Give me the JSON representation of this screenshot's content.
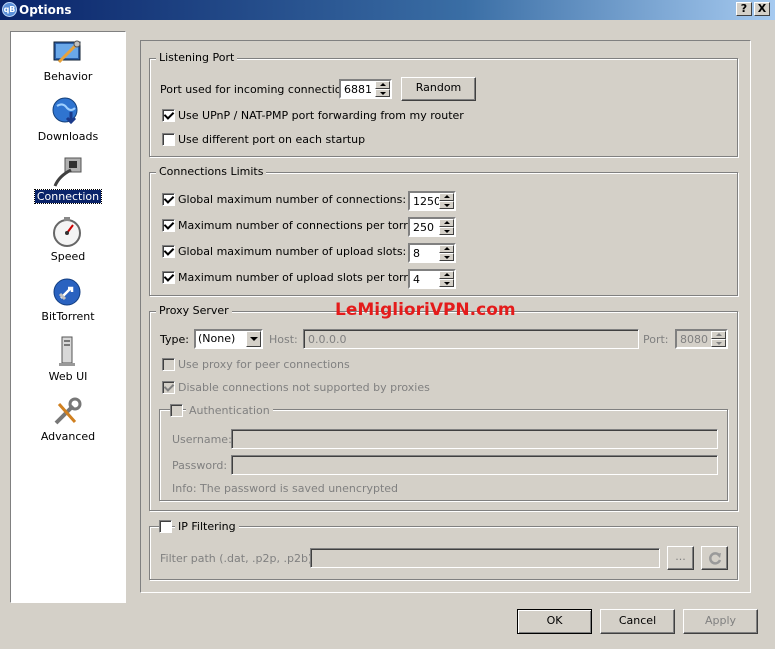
{
  "window": {
    "title": "Options",
    "help_label": "?",
    "close_label": "X"
  },
  "sidebar": {
    "items": [
      {
        "label": "Behavior",
        "icon": "behavior-icon",
        "selected": false
      },
      {
        "label": "Downloads",
        "icon": "downloads-globe-icon",
        "selected": false
      },
      {
        "label": "Connection",
        "icon": "connection-icon",
        "selected": true
      },
      {
        "label": "Speed",
        "icon": "speed-gauge-icon",
        "selected": false
      },
      {
        "label": "BitTorrent",
        "icon": "bittorrent-icon",
        "selected": false
      },
      {
        "label": "Web UI",
        "icon": "web-ui-icon",
        "selected": false
      },
      {
        "label": "Advanced",
        "icon": "advanced-tools-icon",
        "selected": false
      }
    ]
  },
  "listening_port": {
    "title": "Listening Port",
    "port_label": "Port used for incoming connections:",
    "port_value": "6881",
    "random_button": "Random",
    "upnp_label": "Use UPnP / NAT-PMP port forwarding from my router",
    "upnp_checked": true,
    "diff_port_label": "Use different port on each startup",
    "diff_port_checked": false
  },
  "connection_limits": {
    "title": "Connections Limits",
    "rows": [
      {
        "label": "Global maximum number of connections:",
        "value": "1250",
        "checked": true
      },
      {
        "label": "Maximum number of connections per torrent:",
        "value": "250",
        "checked": true
      },
      {
        "label": "Global maximum number of upload slots:",
        "value": "8",
        "checked": true
      },
      {
        "label": "Maximum number of upload slots per torrent:",
        "value": "4",
        "checked": true
      }
    ]
  },
  "proxy": {
    "title": "Proxy Server",
    "type_label": "Type:",
    "type_value": "(None)",
    "host_label": "Host:",
    "host_value": "0.0.0.0",
    "port_label": "Port:",
    "port_value": "8080",
    "peer_label": "Use proxy for peer connections",
    "peer_checked": false,
    "disable_label": "Disable connections not supported by proxies",
    "disable_checked": true,
    "auth_title": "Authentication",
    "auth_checked": false,
    "username_label": "Username:",
    "username_value": "",
    "password_label": "Password:",
    "password_value": "",
    "info_text": "Info: The password is saved unencrypted"
  },
  "ip_filter": {
    "title": "IP Filtering",
    "checked": false,
    "path_label": "Filter path (.dat, .p2p, .p2b):",
    "path_value": "",
    "browse_label": "...",
    "reload_icon": "reload-icon"
  },
  "watermark": "LeMiglioriVPN.com",
  "footer": {
    "ok": "OK",
    "cancel": "Cancel",
    "apply": "Apply"
  },
  "colors": {
    "selection": "#0a246a",
    "watermark": "#e41b1b",
    "face": "#d4d0c8"
  }
}
